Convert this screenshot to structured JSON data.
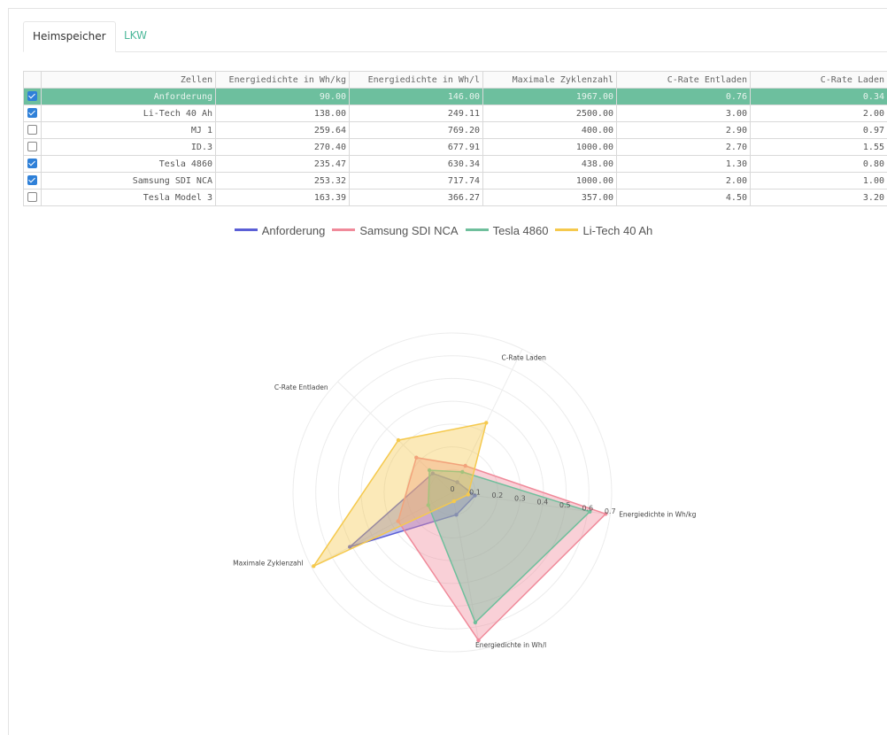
{
  "tabs": [
    {
      "label": "Heimspeicher",
      "active": true
    },
    {
      "label": "LKW",
      "active": false
    }
  ],
  "table": {
    "columns": [
      "Zellen",
      "Energiedichte in Wh/kg",
      "Energiedichte in Wh/l",
      "Maximale Zyklenzahl",
      "C-Rate Entladen",
      "C-Rate Laden"
    ],
    "rows": [
      {
        "checked": true,
        "highlight": true,
        "cells": [
          "Anforderung",
          "90.00",
          "146.00",
          "1967.00",
          "0.76",
          "0.34"
        ]
      },
      {
        "checked": true,
        "highlight": false,
        "cells": [
          "Li-Tech 40 Ah",
          "138.00",
          "249.11",
          "2500.00",
          "3.00",
          "2.00"
        ]
      },
      {
        "checked": false,
        "highlight": false,
        "cells": [
          "MJ 1",
          "259.64",
          "769.20",
          "400.00",
          "2.90",
          "0.97"
        ]
      },
      {
        "checked": false,
        "highlight": false,
        "cells": [
          "ID.3",
          "270.40",
          "677.91",
          "1000.00",
          "2.70",
          "1.55"
        ]
      },
      {
        "checked": true,
        "highlight": false,
        "cells": [
          "Tesla 4860",
          "235.47",
          "630.34",
          "438.00",
          "1.30",
          "0.80"
        ]
      },
      {
        "checked": true,
        "highlight": false,
        "cells": [
          "Samsung SDI NCA",
          "253.32",
          "717.74",
          "1000.00",
          "2.00",
          "1.00"
        ]
      },
      {
        "checked": false,
        "highlight": false,
        "cells": [
          "Tesla Model 3",
          "163.39",
          "366.27",
          "357.00",
          "4.50",
          "3.20"
        ]
      }
    ]
  },
  "chart_data": {
    "type": "radar",
    "axes": [
      "Energiedichte in Wh/kg",
      "Energiedichte in Wh/l",
      "Maximale Zyklenzahl",
      "C-Rate Entladen",
      "C-Rate Laden"
    ],
    "rlim": [
      0,
      0.7
    ],
    "ticks": [
      "0",
      "0.1",
      "0.2",
      "0.3",
      "0.4",
      "0.5",
      "0.6",
      "0.7"
    ],
    "grid": true,
    "legend_position": "top",
    "series": [
      {
        "name": "Anforderung",
        "color": "#5b5fd6",
        "values": [
          0.1,
          0.1,
          0.51,
          0.12,
          0.05
        ]
      },
      {
        "name": "Samsung SDI NCA",
        "color": "#f08a9a",
        "values": [
          0.68,
          0.66,
          0.27,
          0.22,
          0.13
        ]
      },
      {
        "name": "Tesla 4860",
        "color": "#6fbf9c",
        "values": [
          0.61,
          0.58,
          0.12,
          0.14,
          0.1
        ]
      },
      {
        "name": "Li-Tech 40 Ah",
        "color": "#f5c94d",
        "values": [
          0.07,
          0.04,
          0.69,
          0.33,
          0.34
        ]
      }
    ]
  }
}
